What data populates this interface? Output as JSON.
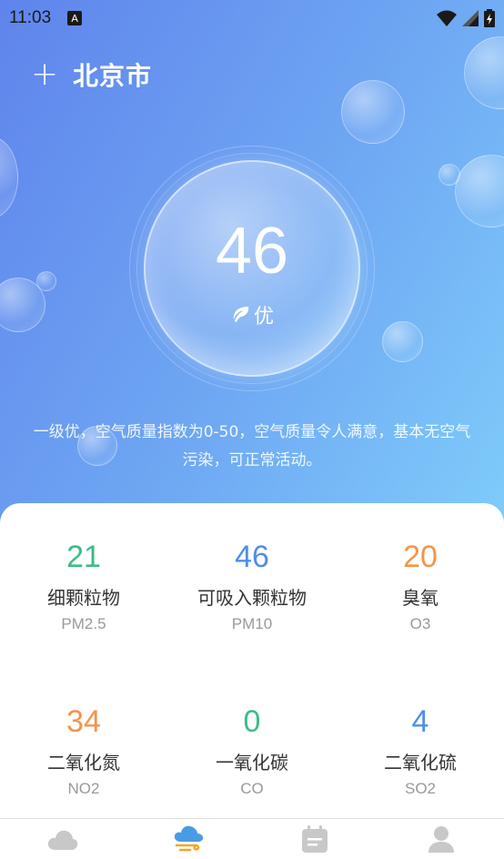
{
  "status_bar": {
    "time": "11:03",
    "notification_icon_label": "A"
  },
  "header": {
    "add_label": "+",
    "city": "北京市"
  },
  "aqi": {
    "value": "46",
    "level": "优",
    "description": "一级优，空气质量指数为0-50，空气质量令人满意，基本无空气污染，可正常活动。"
  },
  "pollutants": [
    {
      "value": "21",
      "name": "细颗粒物",
      "code": "PM2.5",
      "color": "#3dbb86"
    },
    {
      "value": "46",
      "name": "可吸入颗粒物",
      "code": "PM10",
      "color": "#4f8ee8"
    },
    {
      "value": "20",
      "name": "臭氧",
      "code": "O3",
      "color": "#f5944a"
    },
    {
      "value": "34",
      "name": "二氧化氮",
      "code": "NO2",
      "color": "#f5944a"
    },
    {
      "value": "0",
      "name": "一氧化碳",
      "code": "CO",
      "color": "#3dbb86"
    },
    {
      "value": "4",
      "name": "二氧化硫",
      "code": "SO2",
      "color": "#4f8ee8"
    }
  ],
  "tabs": [
    {
      "icon": "cloud-icon",
      "active": false
    },
    {
      "icon": "air-quality-icon",
      "active": true
    },
    {
      "icon": "calendar-icon",
      "active": false
    },
    {
      "icon": "user-icon",
      "active": false
    }
  ],
  "colors": {
    "gradient_start": "#5f84ec",
    "gradient_end": "#7fcdfb",
    "tab_inactive": "#c8c8c8",
    "tab_active": "#4a9be6"
  }
}
